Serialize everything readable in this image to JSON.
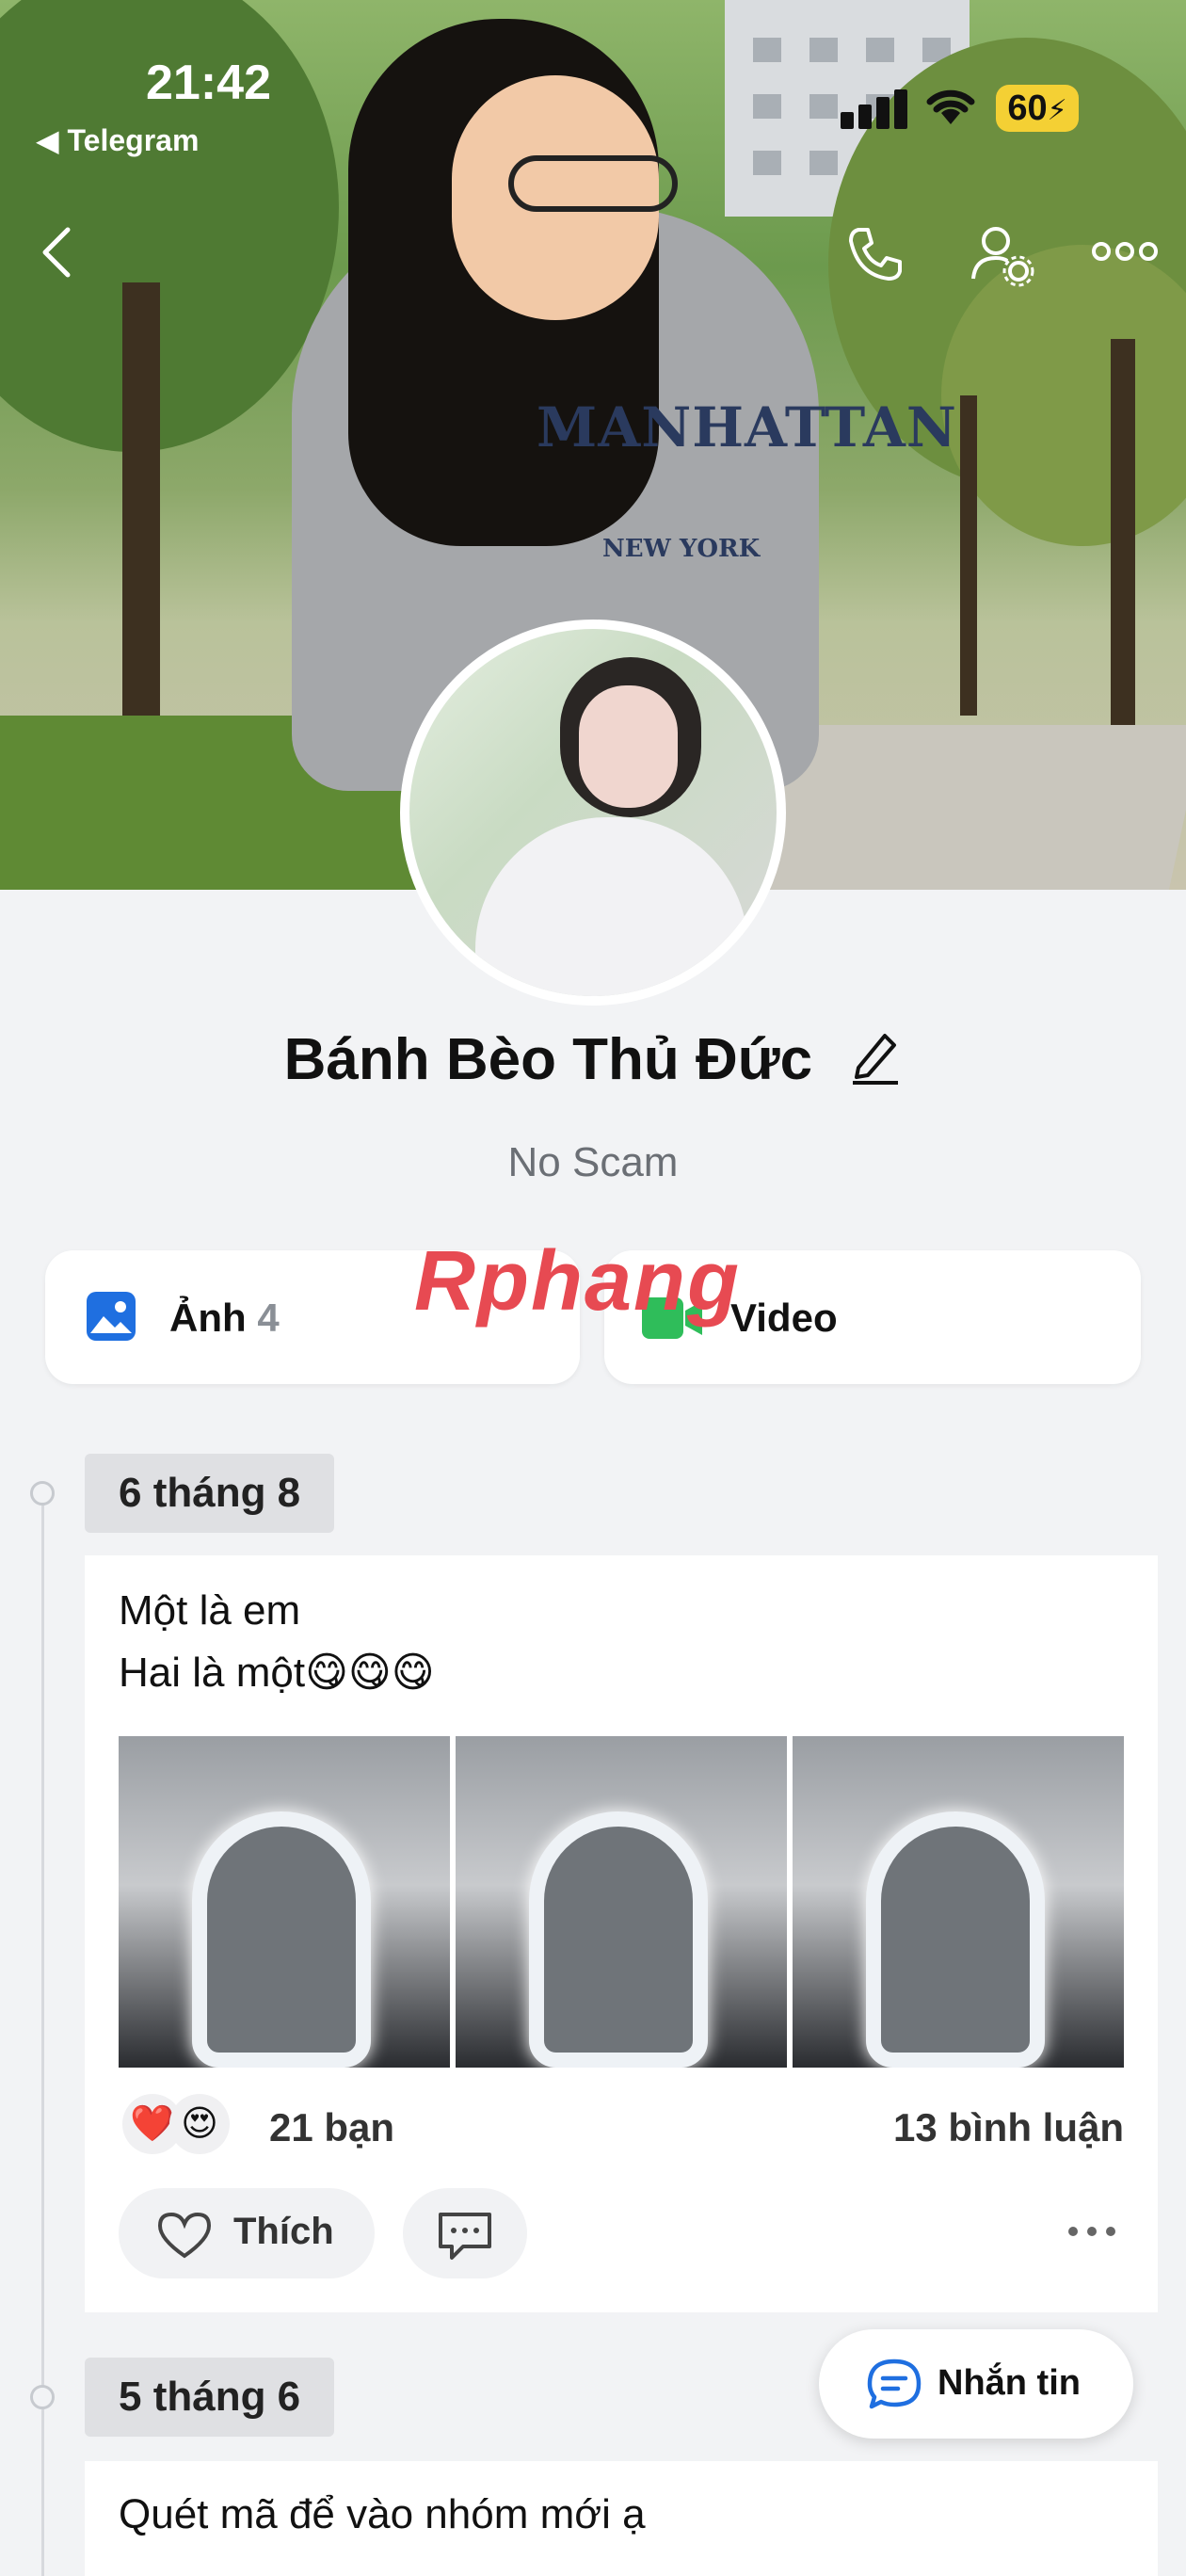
{
  "status_bar": {
    "time": "21:42",
    "back_app": "◀ Telegram",
    "battery": "60"
  },
  "cover": {
    "shirt_text": "MANHATTAN",
    "shirt_sub": "NEW YORK"
  },
  "profile": {
    "name": "Bánh Bèo Thủ Đức",
    "bio": "No Scam"
  },
  "tiles": [
    {
      "label": "Ảnh",
      "count": "4"
    },
    {
      "label": "Video"
    }
  ],
  "watermark": "Rphang",
  "posts": [
    {
      "date": "6 tháng 8",
      "text_lines": [
        "Một là em",
        "Hai là một😋😋😋"
      ],
      "reaction_emojis": [
        "❤️",
        "😍"
      ],
      "reaction_count": "21 bạn",
      "comment_count": "13 bình luận",
      "like_label": "Thích"
    },
    {
      "date": "5 tháng 6",
      "text_lines": [
        "Quét mã để vào nhóm mới ạ"
      ]
    }
  ],
  "message_button": {
    "label": "Nhắn tin"
  },
  "colors": {
    "accent": "#1f6fe0",
    "video_green": "#2fbd5a",
    "heart_red": "#e6193a"
  }
}
